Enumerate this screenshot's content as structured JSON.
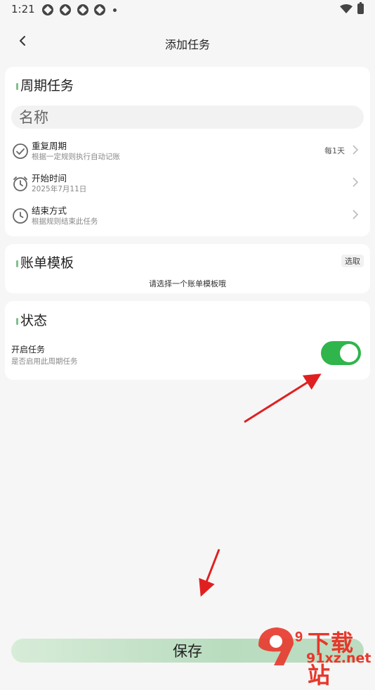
{
  "status_bar": {
    "time": "1:21"
  },
  "header": {
    "title": "添加任务"
  },
  "periodic": {
    "title": "周期任务",
    "name_placeholder": "名称",
    "rows": [
      {
        "title": "重复周期",
        "subtitle": "根据一定规则执行自动记账",
        "value": "每1天"
      },
      {
        "title": "开始时间",
        "subtitle": "2025年7月11日",
        "value": ""
      },
      {
        "title": "结束方式",
        "subtitle": "根据规则结束此任务",
        "value": ""
      }
    ]
  },
  "template": {
    "title": "账单模板",
    "select_label": "选取",
    "hint": "请选择一个账单模板哦"
  },
  "status": {
    "title": "状态",
    "toggle_label": "开启任务",
    "toggle_sub": "是否启用此周期任务",
    "enabled": true
  },
  "save_label": "保存",
  "watermark": {
    "logo_text": "9",
    "top": "下载站",
    "bottom": "91xz.net"
  },
  "colors": {
    "accent": "#2fb54b",
    "section_mark": "#7fc08f",
    "arrow": "#e02020"
  }
}
